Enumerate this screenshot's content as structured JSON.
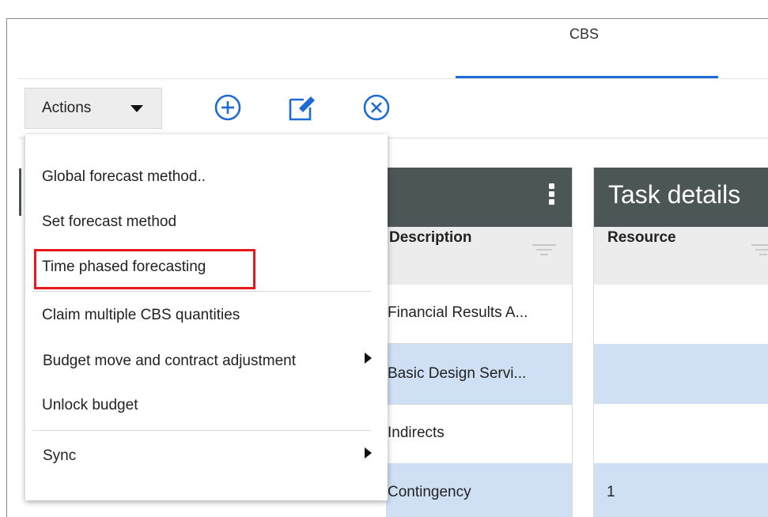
{
  "tabs": {
    "active_label": "CBS"
  },
  "toolbar": {
    "actions_label": "Actions",
    "icons": [
      "add-circle-icon",
      "edit-icon",
      "close-circle-icon"
    ],
    "accent_color": "#1f6bd6"
  },
  "menu": {
    "items": [
      {
        "label": "Global forecast method..",
        "has_submenu": false
      },
      {
        "label": "Set forecast method",
        "has_submenu": false
      },
      {
        "label": "Time phased forecasting",
        "has_submenu": false,
        "highlighted": true
      },
      {
        "label": "Claim multiple CBS quantities",
        "has_submenu": false
      },
      {
        "label": "Budget move and contract adjustment",
        "has_submenu": true
      },
      {
        "label": "Unlock budget",
        "has_submenu": false
      },
      {
        "label": "Sync",
        "has_submenu": true
      }
    ],
    "highlight_color": "#e8191d"
  },
  "grid": {
    "task_details_title": "Task details",
    "columns": [
      "Description",
      "Resource"
    ],
    "rows": [
      {
        "description": "Financial Results A...",
        "resource": "",
        "selected": false
      },
      {
        "description": "Basic Design Servi...",
        "resource": "",
        "selected": true
      },
      {
        "description": "Indirects",
        "resource": "",
        "selected": false
      },
      {
        "description": "Contingency",
        "resource": "1",
        "selected": true
      }
    ],
    "header_color": "#4d5656",
    "selected_row_color": "#cfe0f5"
  }
}
